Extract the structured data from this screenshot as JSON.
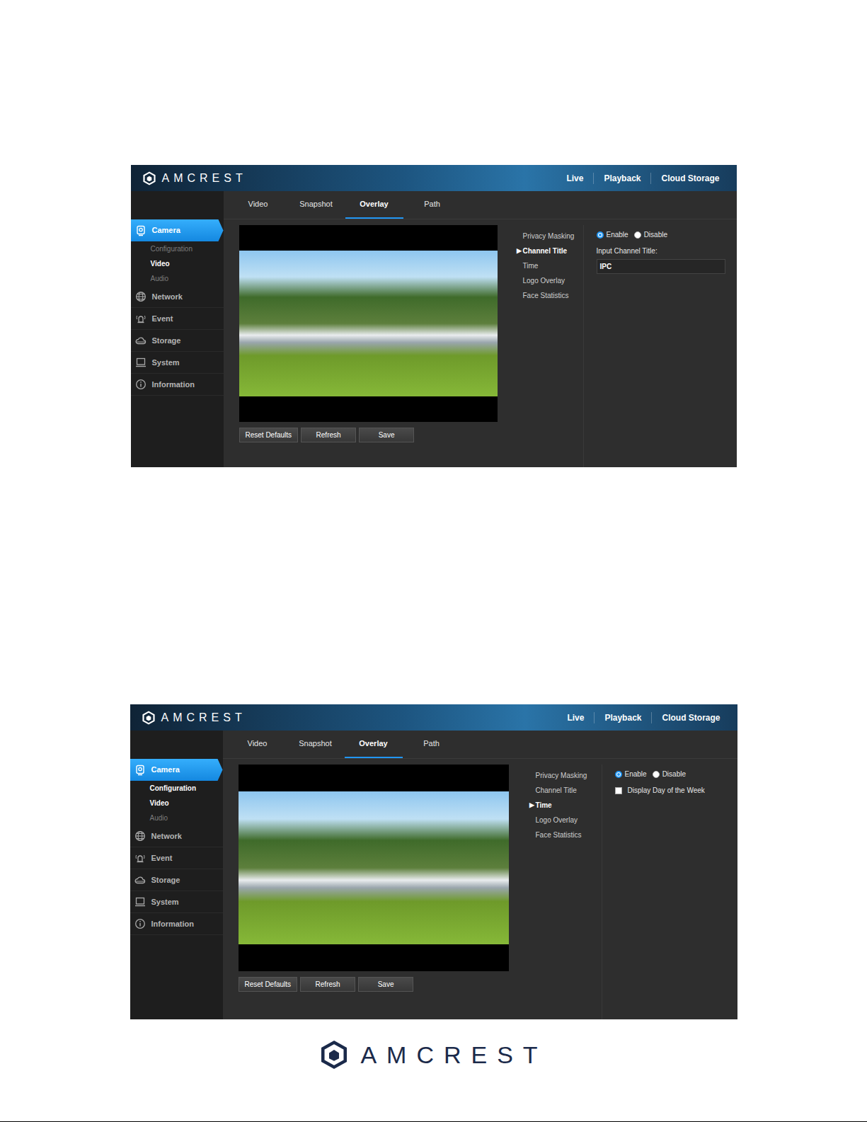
{
  "screens": [
    {
      "header": {
        "brand": "AMCREST",
        "nav": [
          "Live",
          "Playback",
          "Cloud Storage"
        ]
      },
      "tabs": [
        {
          "label": "Video",
          "selected": false
        },
        {
          "label": "Snapshot",
          "selected": false
        },
        {
          "label": "Overlay",
          "selected": true
        },
        {
          "label": "Path",
          "selected": false
        }
      ],
      "sidebar": [
        {
          "label": "Camera",
          "selected": true,
          "children": [
            {
              "label": "Configuration",
              "selected": false
            },
            {
              "label": "Video",
              "selected": true
            },
            {
              "label": "Audio",
              "selected": false
            }
          ]
        },
        {
          "label": "Network",
          "selected": false,
          "children": []
        },
        {
          "label": "Event",
          "selected": false,
          "children": []
        },
        {
          "label": "Storage",
          "selected": false,
          "children": []
        },
        {
          "label": "System",
          "selected": false,
          "children": []
        },
        {
          "label": "Information",
          "selected": false,
          "children": []
        }
      ],
      "submenu": {
        "marker": "▶",
        "items": [
          {
            "label": "Privacy Masking",
            "selected": false
          },
          {
            "label": "Channel Title",
            "selected": true
          },
          {
            "label": "Time",
            "selected": false
          },
          {
            "label": "Logo Overlay",
            "selected": false
          },
          {
            "label": "Face Statistics",
            "selected": false
          }
        ]
      },
      "settings": {
        "radios": [
          {
            "label": "Enable",
            "selected": true
          },
          {
            "label": "Disable",
            "selected": false
          }
        ],
        "field": {
          "label": "Input Channel Title:",
          "value": "IPC"
        }
      },
      "buttons": [
        "Reset Defaults",
        "Refresh",
        "Save"
      ]
    },
    {
      "header": {
        "brand": "AMCREST",
        "nav": [
          "Live",
          "Playback",
          "Cloud Storage"
        ]
      },
      "tabs": [
        {
          "label": "Video",
          "selected": false
        },
        {
          "label": "Snapshot",
          "selected": false
        },
        {
          "label": "Overlay",
          "selected": true
        },
        {
          "label": "Path",
          "selected": false
        }
      ],
      "sidebar": [
        {
          "label": "Camera",
          "selected": true,
          "children": [
            {
              "label": "Configuration",
              "selected": true
            },
            {
              "label": "Video",
              "selected": true
            },
            {
              "label": "Audio",
              "selected": false
            }
          ]
        },
        {
          "label": "Network",
          "selected": false,
          "children": []
        },
        {
          "label": "Event",
          "selected": false,
          "children": []
        },
        {
          "label": "Storage",
          "selected": false,
          "children": []
        },
        {
          "label": "System",
          "selected": false,
          "children": []
        },
        {
          "label": "Information",
          "selected": false,
          "children": []
        }
      ],
      "submenu": {
        "marker": "▶",
        "items": [
          {
            "label": "Privacy Masking",
            "selected": false
          },
          {
            "label": "Channel Title",
            "selected": false
          },
          {
            "label": "Time",
            "selected": true
          },
          {
            "label": "Logo Overlay",
            "selected": false
          },
          {
            "label": "Face Statistics",
            "selected": false
          }
        ]
      },
      "settings": {
        "radios": [
          {
            "label": "Enable",
            "selected": true
          },
          {
            "label": "Disable",
            "selected": false
          }
        ],
        "checkbox": {
          "label": "Display Day of the Week",
          "checked": false
        }
      },
      "buttons": [
        "Reset Defaults",
        "Refresh",
        "Save"
      ]
    }
  ],
  "footer": {
    "brand": "AMCREST"
  }
}
